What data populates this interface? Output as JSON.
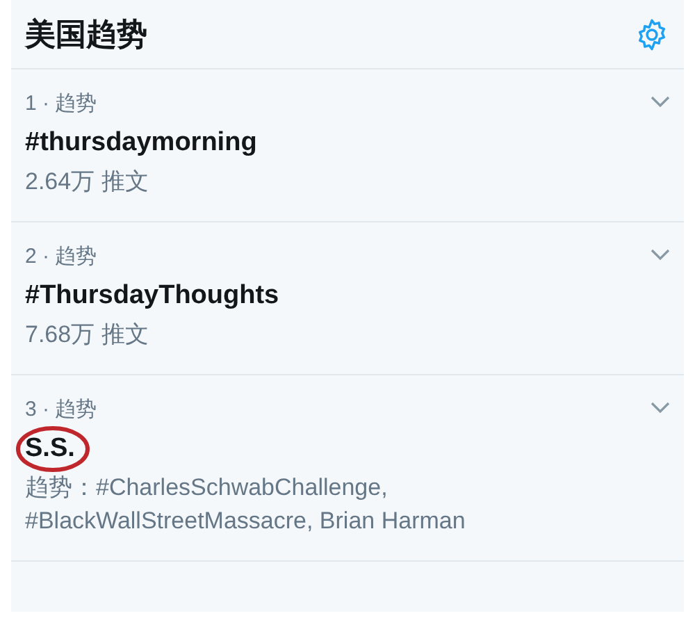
{
  "header": {
    "title": "美国趋势"
  },
  "trends": [
    {
      "meta": "1 · 趋势",
      "name": "#thursdaymorning",
      "detail": "2.64万 推文",
      "highlighted": false
    },
    {
      "meta": "2 · 趋势",
      "name": "#ThursdayThoughts",
      "detail": "7.68万 推文",
      "highlighted": false
    },
    {
      "meta": "3 · 趋势",
      "name": "S.S.",
      "detail": "趋势：#CharlesSchwabChallenge, #BlackWallStreetMassacre, Brian Harman",
      "highlighted": true
    }
  ]
}
